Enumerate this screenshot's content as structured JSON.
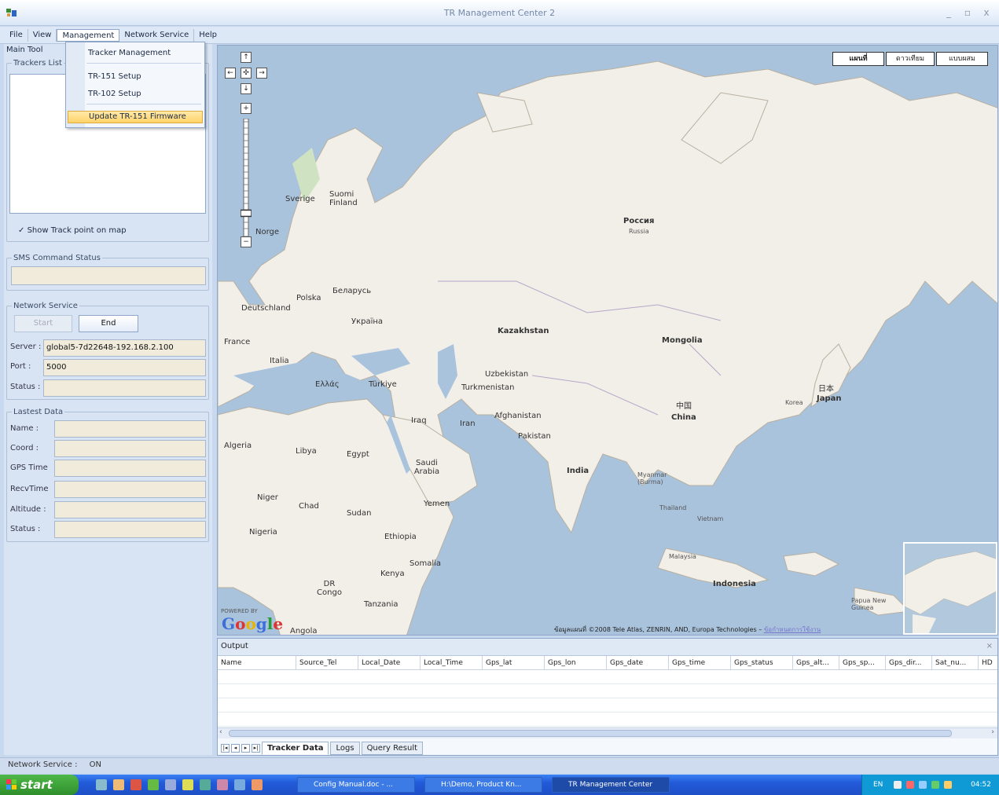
{
  "window": {
    "title": "TR Management Center 2",
    "controls": [
      "_",
      "▫",
      "x"
    ]
  },
  "menubar": {
    "items": [
      "File",
      "View",
      "Management",
      "Network Service",
      "Help"
    ]
  },
  "management_menu": {
    "items": [
      "Tracker Management",
      "TR-151 Setup",
      "TR-102 Setup",
      "Update TR-151 Firmware"
    ],
    "highlighted": "Update TR-151 Firmware"
  },
  "left_panel": {
    "title": "Main Tool",
    "trackers_list_label": "Trackers List",
    "show_track_point": "Show Track point on map",
    "sms_status_label": "SMS Command Status",
    "network_service": {
      "label": "Network Service",
      "start_button": "Start",
      "end_button": "End",
      "server_label": "Server :",
      "server_value": "global5-7d22648-192.168.2.100",
      "port_label": "Port :",
      "port_value": "5000",
      "status_label": "Status :"
    },
    "lastest_data": {
      "label": "Lastest Data",
      "fields": [
        "Name :",
        "Coord :",
        "GPS Time",
        "RecvTime",
        "Altitude :",
        "Status :"
      ]
    }
  },
  "map": {
    "map_types": [
      "แผนที่",
      "ดาวเทียม",
      "แบบผสม"
    ],
    "active_map_type": "แผนที่",
    "nav_buttons": [
      "↑",
      "←",
      "✣",
      "→",
      "↓",
      "+",
      "−"
    ],
    "zoom_level_fraction": 0.18,
    "labels": {
      "russia": "Россия",
      "russia_en": "Russia",
      "kazakhstan": "Kazakhstan",
      "mongolia": "Mongolia",
      "china_local": "中国",
      "china": "China",
      "japan_local": "日本",
      "japan": "Japan",
      "india": "India",
      "indonesia": "Indonesia",
      "turkiye": "Türkiye",
      "iran": "Iran",
      "iraq": "Iraq",
      "afghanistan": "Afghanistan",
      "pakistan": "Pakistan",
      "uzbekistan": "Uzbekistan",
      "turkmenistan": "Turkmenistan",
      "saudi_arabia": "Saudi Arabia",
      "egypt": "Egypt",
      "libya": "Libya",
      "algeria": "Algeria",
      "niger": "Niger",
      "chad": "Chad",
      "sudan": "Sudan",
      "ethiopia": "Ethiopia",
      "nigeria": "Nigeria",
      "somalia": "Somalia",
      "kenya": "Kenya",
      "dr_congo": "DR Congo",
      "tanzania": "Tanzania",
      "angola": "Angola",
      "yemen": "Yemen",
      "france": "France",
      "italia": "Italia",
      "deutschland": "Deutschland",
      "polska": "Polska",
      "ukraine": "Україна",
      "belarus": "Беларусь",
      "sverige": "Sverige",
      "suomi": "Suomi Finland",
      "norge": "Norge",
      "greece": "Ελλάς",
      "myanmar": "Myanmar (Burma)",
      "thailand": "Thailand",
      "vietnam": "Vietnam",
      "malaysia": "Malaysia",
      "papua": "Papua New Guinea",
      "korea": "Korea"
    },
    "google_logo": "Google",
    "powered_by": "POWERED BY",
    "attribution": "ข้อมูลแผนที่ ©2008 Tele Atlas, ZENRIN, AND, Europa Technologies – ",
    "terms_link": "ข้อกำหนดการใช้งาน"
  },
  "output": {
    "title": "Output",
    "columns": [
      "Name",
      "Source_Tel",
      "Local_Date",
      "Local_Time",
      "Gps_lat",
      "Gps_lon",
      "Gps_date",
      "Gps_time",
      "Gps_status",
      "Gps_alt...",
      "Gps_sp...",
      "Gps_dir...",
      "Sat_nu...",
      "HD"
    ],
    "tabs": [
      "Tracker Data",
      "Logs",
      "Query Result"
    ],
    "active_tab": "Tracker Data"
  },
  "statusbar": {
    "label": "Network Service :",
    "value": "ON"
  },
  "taskbar": {
    "start": "start",
    "tasks": [
      "Config Manual.doc - ...",
      "H:\\Demo, Product Kn...",
      "TR Management Center"
    ],
    "active_task": "TR Management Center",
    "tray_lang": "EN",
    "clock": "04:52"
  },
  "colors": {
    "map_water": "#aac3dd",
    "map_land": "#f2efe9",
    "menu_highlight": "#ffd36a",
    "taskbar": "#225ad8",
    "start": "#2f8f2b"
  }
}
